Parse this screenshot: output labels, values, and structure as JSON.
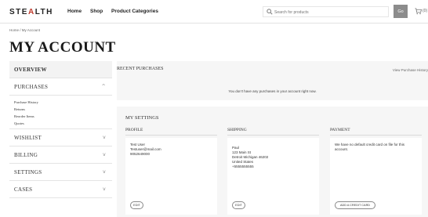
{
  "header": {
    "logo_pre": "STE",
    "logo_x": "A",
    "logo_post": "LTH",
    "nav": [
      "Home",
      "Shop",
      "Product Categories"
    ],
    "search_placeholder": "Search for products",
    "go_label": "Go",
    "cart_count": "(0)"
  },
  "breadcrumb": "Home / My Account",
  "page_title": "MY ACCOUNT",
  "sidebar": {
    "items": [
      {
        "label": "OVERVIEW",
        "chevron": ""
      },
      {
        "label": "PURCHASES",
        "chevron": "^"
      },
      {
        "label": "WISHLIST",
        "chevron": "v"
      },
      {
        "label": "BILLING",
        "chevron": "v"
      },
      {
        "label": "SETTINGS",
        "chevron": "v"
      },
      {
        "label": "CASES",
        "chevron": "v"
      }
    ],
    "purchases_sub": [
      "Purchase History",
      "Returns",
      "Reorder Items",
      "Quotes"
    ]
  },
  "recent": {
    "title": "RECENT PURCHASES",
    "link": "View Purchase History",
    "empty": "You don't have any purchases in your account right now."
  },
  "settings": {
    "title": "MY SETTINGS",
    "profile": {
      "heading": "PROFILE",
      "lines": [
        "Test User",
        "Testuser@mail.com",
        "9052649000"
      ],
      "button": "EDIT"
    },
    "shipping": {
      "heading": "SHIPPING",
      "lines": [
        "Paul",
        "123 Main St",
        "Detroit Michigan 46202",
        "United States",
        "+5555555555"
      ],
      "button": "EDIT"
    },
    "payment": {
      "heading": "PAYMENT",
      "lines": [
        "We have no default credit card on file for this",
        "account."
      ],
      "button": "ADD A CREDIT CARD"
    }
  },
  "colors": {
    "accent": "#c0392b",
    "go_button": "#8c8c8c",
    "panel_bg": "#f6f6f6",
    "active_bg": "#f3f3f3"
  }
}
